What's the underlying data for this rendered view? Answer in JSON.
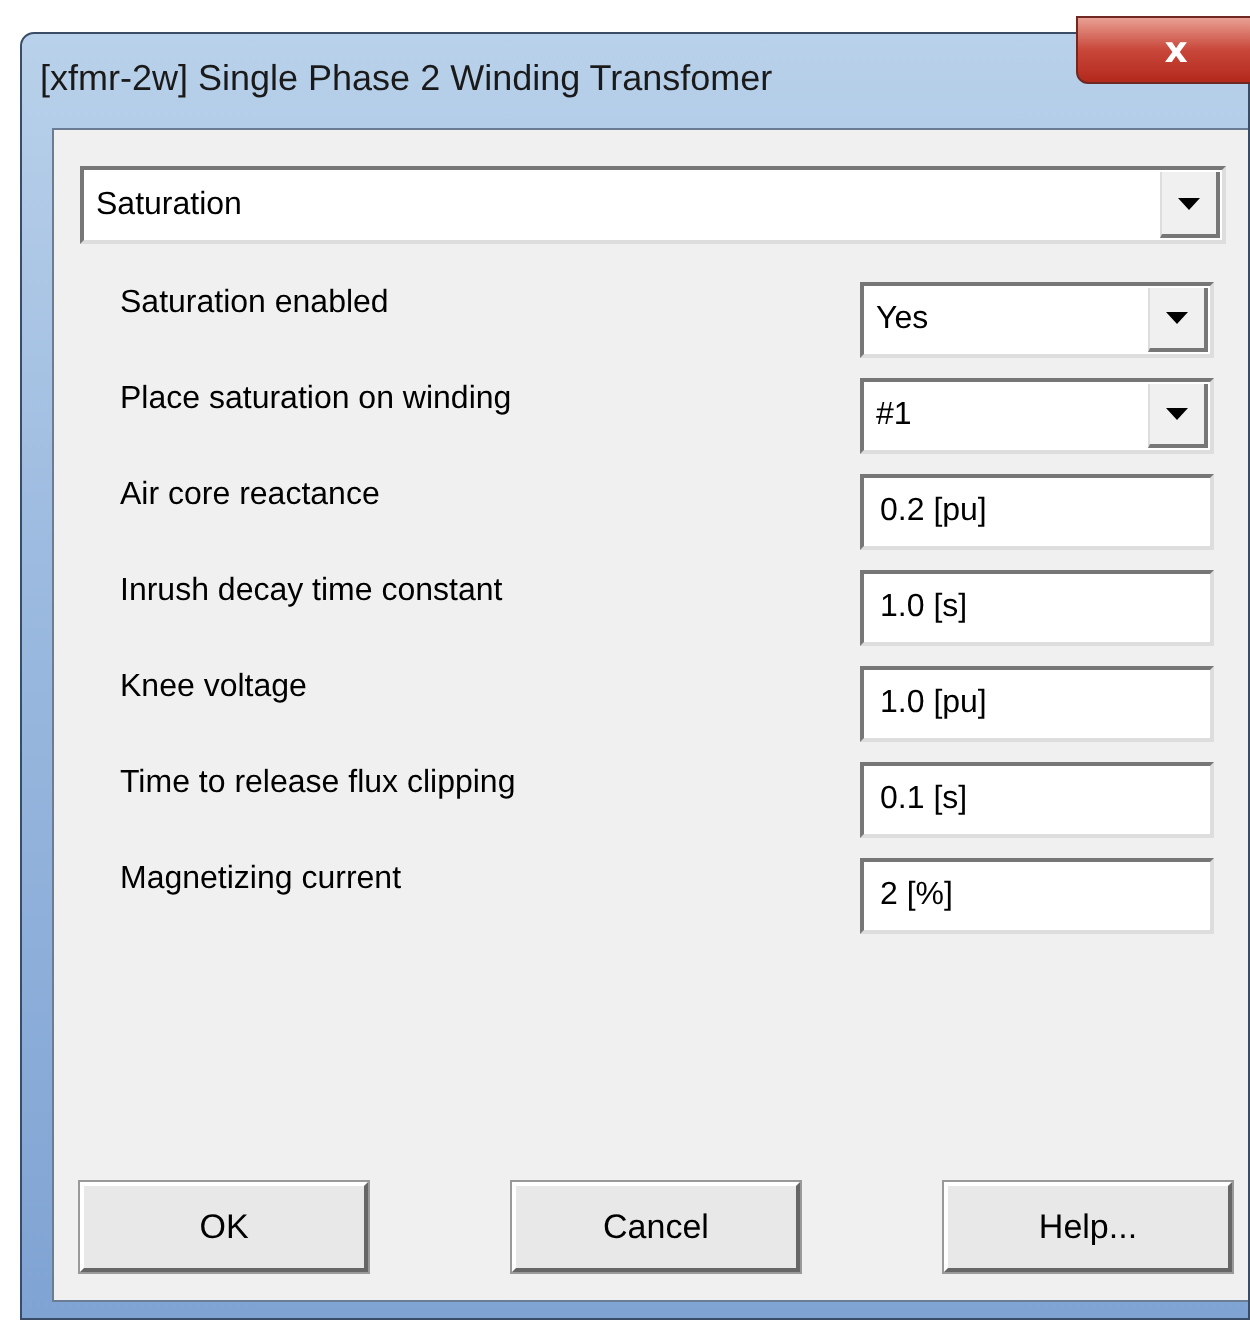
{
  "window": {
    "title": "[xfmr-2w] Single Phase 2 Winding Transfomer",
    "close_icon": "x"
  },
  "category": {
    "value": "Saturation"
  },
  "fields": [
    {
      "label": "Saturation enabled",
      "kind": "dropdown",
      "value": "Yes"
    },
    {
      "label": "Place saturation on winding",
      "kind": "dropdown",
      "value": "#1"
    },
    {
      "label": "Air core reactance",
      "kind": "text",
      "value": "0.2 [pu]"
    },
    {
      "label": "Inrush decay time constant",
      "kind": "text",
      "value": "1.0 [s]"
    },
    {
      "label": "Knee voltage",
      "kind": "text",
      "value": "1.0 [pu]"
    },
    {
      "label": "Time to release flux clipping",
      "kind": "text",
      "value": "0.1 [s]"
    },
    {
      "label": "Magnetizing current",
      "kind": "text",
      "value": "2 [%]"
    }
  ],
  "buttons": [
    "OK",
    "Cancel",
    "Help..."
  ]
}
